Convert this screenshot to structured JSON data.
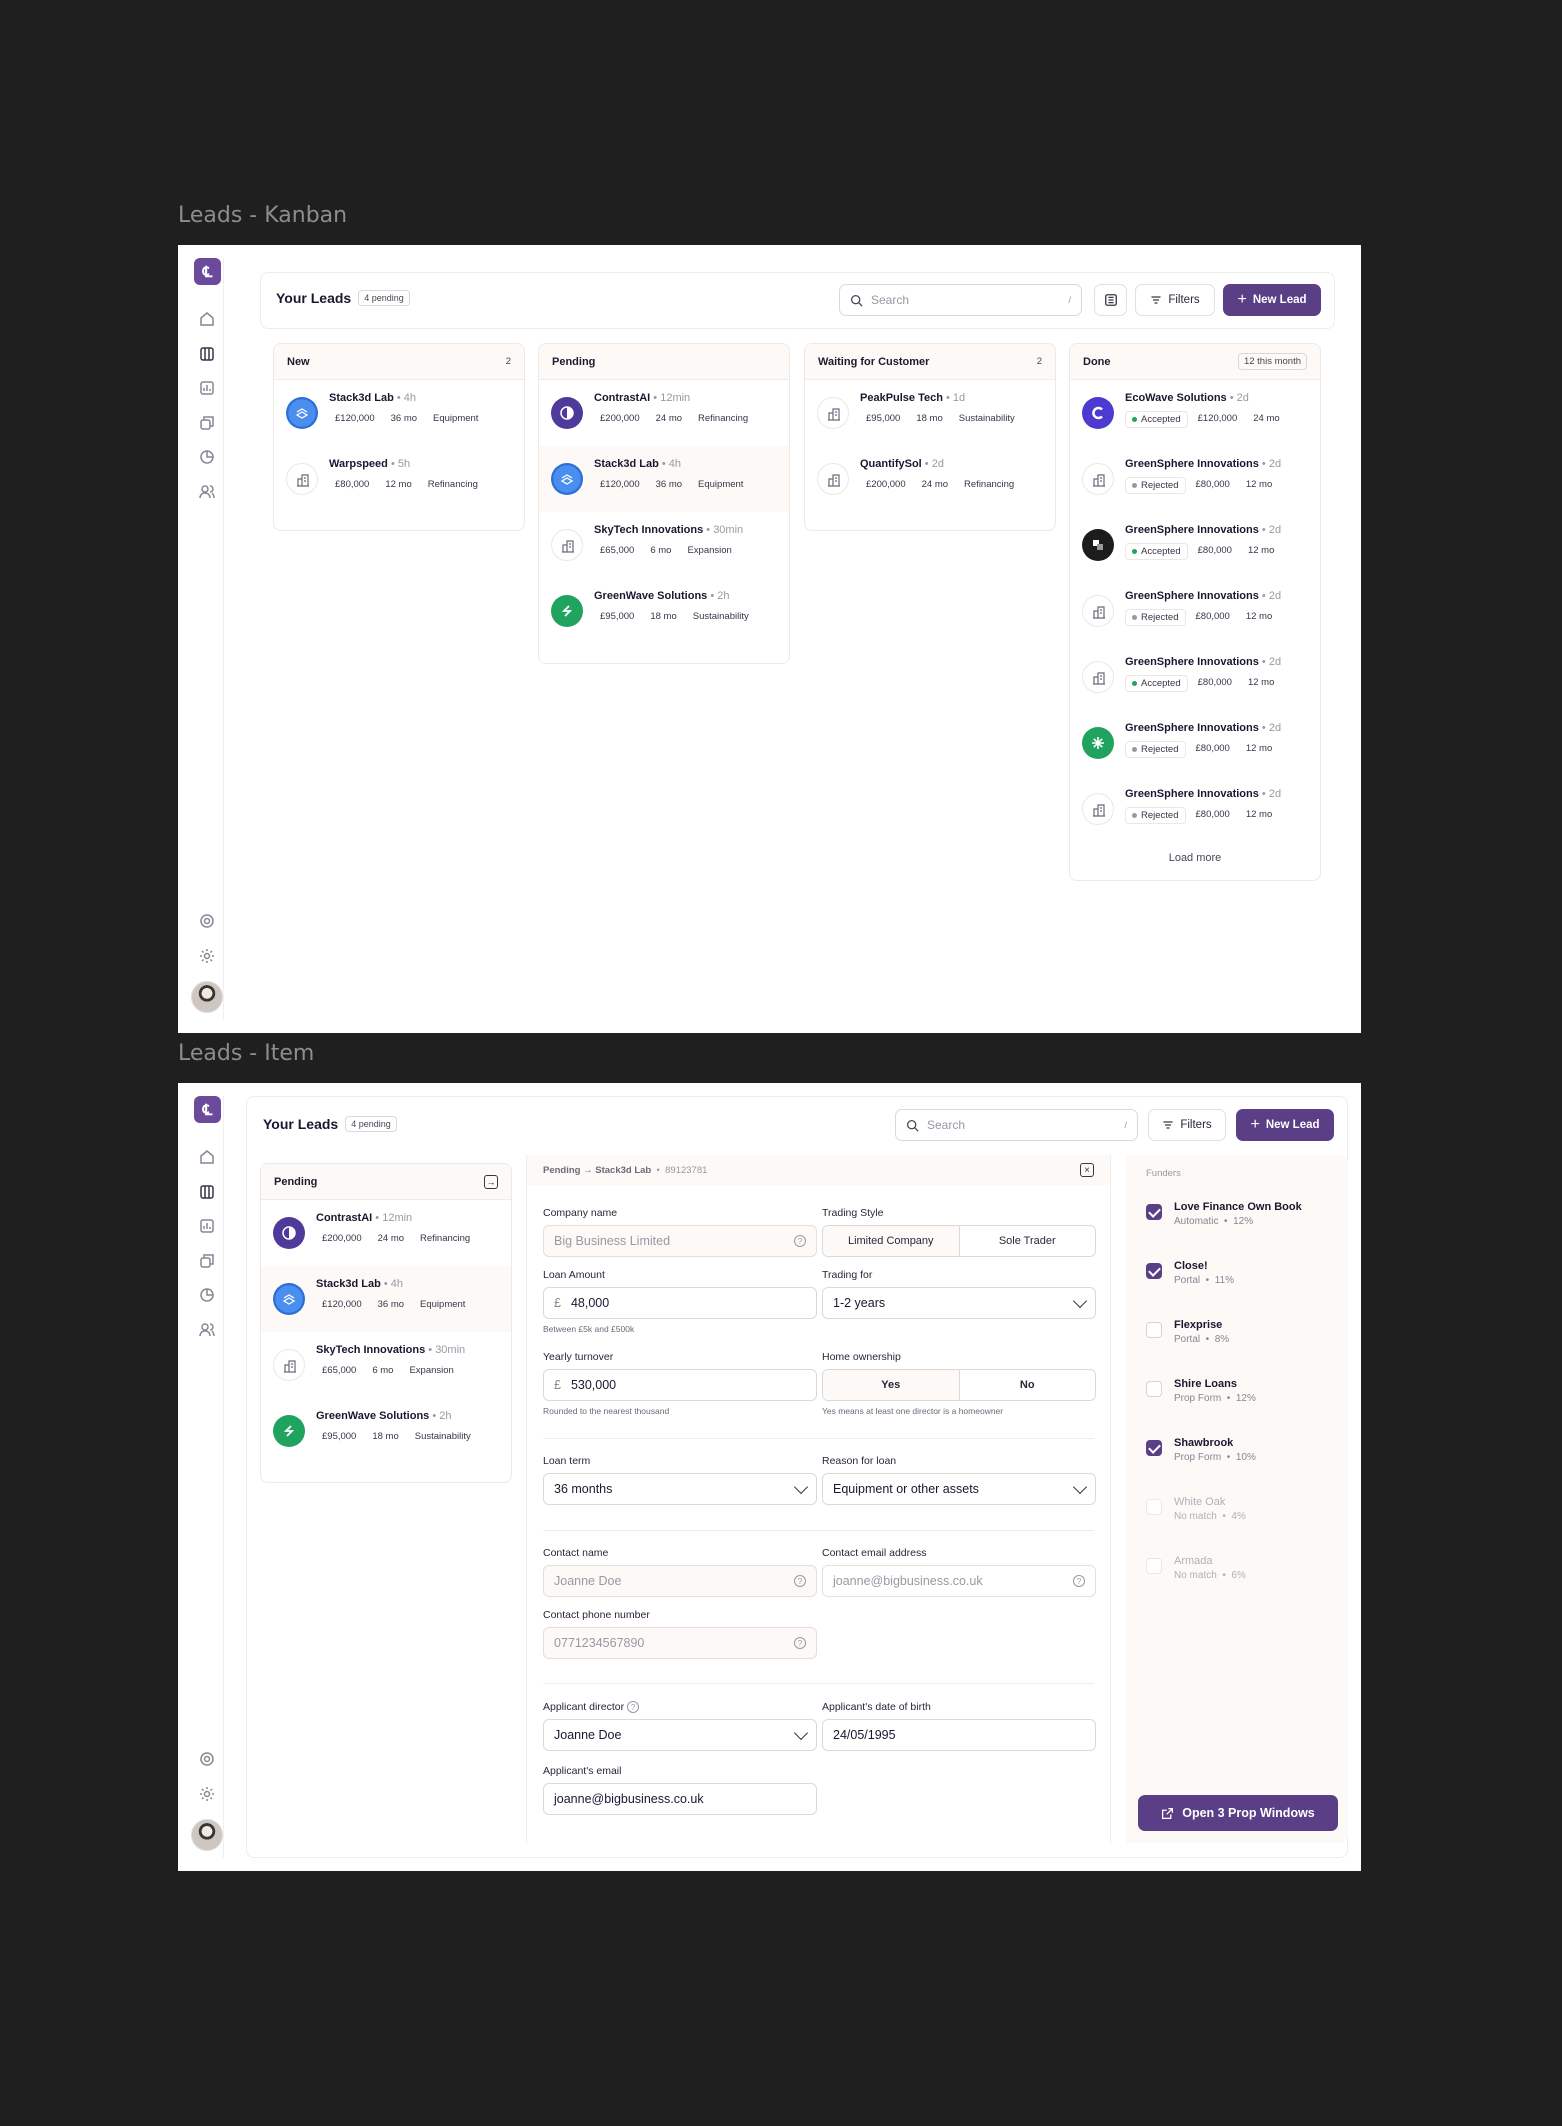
{
  "frames": {
    "kanban_title": "Leads - Kanban",
    "item_title": "Leads - Item"
  },
  "header": {
    "title": "Your Leads",
    "pending_badge": "4 pending",
    "search_placeholder": "Search",
    "search_shortcut": "/",
    "filters_label": "Filters",
    "new_lead_label": "New Lead"
  },
  "kanban": {
    "columns": [
      {
        "title": "New",
        "count": "2",
        "leads": [
          {
            "name": "Stack3d Lab",
            "ago": "4h",
            "amount": "£120,000",
            "term": "36 mo",
            "purpose": "Equipment",
            "icon": "stack3d-logo"
          },
          {
            "name": "Warpspeed",
            "ago": "5h",
            "amount": "£80,000",
            "term": "12 mo",
            "purpose": "Refinancing",
            "icon": "building-icon"
          }
        ]
      },
      {
        "title": "Pending",
        "count": "",
        "leads": [
          {
            "name": "ContrastAI",
            "ago": "12min",
            "amount": "£200,000",
            "term": "24 mo",
            "purpose": "Refinancing",
            "icon": "contrastai-logo"
          },
          {
            "name": "Stack3d Lab",
            "ago": "4h",
            "amount": "£120,000",
            "term": "36 mo",
            "purpose": "Equipment",
            "icon": "stack3d-logo"
          },
          {
            "name": "SkyTech Innovations",
            "ago": "30min",
            "amount": "£65,000",
            "term": "6 mo",
            "purpose": "Expansion",
            "icon": "building-icon"
          },
          {
            "name": "GreenWave Solutions",
            "ago": "2h",
            "amount": "£95,000",
            "term": "18 mo",
            "purpose": "Sustainability",
            "icon": "greenwave-logo"
          }
        ]
      },
      {
        "title": "Waiting for Customer",
        "count": "2",
        "leads": [
          {
            "name": "PeakPulse Tech",
            "ago": "1d",
            "amount": "£95,000",
            "term": "18 mo",
            "purpose": "Sustainability",
            "icon": "building-icon"
          },
          {
            "name": "QuantifySol",
            "ago": "2d",
            "amount": "£200,000",
            "term": "24 mo",
            "purpose": "Refinancing",
            "icon": "building-icon"
          }
        ]
      },
      {
        "title": "Done",
        "count": "12 this month",
        "leads": [
          {
            "name": "EcoWave Solutions",
            "ago": "2d",
            "status": "Accepted",
            "amount": "£120,000",
            "term": "24 mo",
            "icon": "ecowave-logo"
          },
          {
            "name": "GreenSphere Innovations",
            "ago": "2d",
            "status": "Rejected",
            "amount": "£80,000",
            "term": "12 mo",
            "icon": "building-icon"
          },
          {
            "name": "GreenSphere Innovations",
            "ago": "2d",
            "status": "Accepted",
            "amount": "£80,000",
            "term": "12 mo",
            "icon": "dark-logo"
          },
          {
            "name": "GreenSphere Innovations",
            "ago": "2d",
            "status": "Rejected",
            "amount": "£80,000",
            "term": "12 mo",
            "icon": "building-icon"
          },
          {
            "name": "GreenSphere Innovations",
            "ago": "2d",
            "status": "Accepted",
            "amount": "£80,000",
            "term": "12 mo",
            "icon": "building-icon"
          },
          {
            "name": "GreenSphere Innovations",
            "ago": "2d",
            "status": "Rejected",
            "amount": "£80,000",
            "term": "12 mo",
            "icon": "asterisk-logo"
          },
          {
            "name": "GreenSphere Innovations",
            "ago": "2d",
            "status": "Rejected",
            "amount": "£80,000",
            "term": "12 mo",
            "icon": "building-icon"
          }
        ],
        "load_more": "Load more"
      }
    ]
  },
  "item": {
    "breadcrumb": {
      "status": "Pending",
      "arrow": "→",
      "company": "Stack3d Lab",
      "id": "89123781"
    },
    "fields": {
      "company_name": {
        "label": "Company name",
        "placeholder": "Big Business Limited"
      },
      "trading_style": {
        "label": "Trading Style",
        "options": [
          "Limited Company",
          "Sole Trader"
        ]
      },
      "loan_amount": {
        "label": "Loan Amount",
        "currency": "£",
        "value": "48,000",
        "hint": "Between £5k and £500k"
      },
      "trading_for": {
        "label": "Trading for",
        "value": "1-2 years"
      },
      "yearly_turnover": {
        "label": "Yearly turnover",
        "currency": "£",
        "value": "530,000",
        "hint": "Rounded to the nearest thousand"
      },
      "home_ownership": {
        "label": "Home ownership",
        "options": [
          "Yes",
          "No"
        ],
        "hint": "Yes means at least one director is a homeowner"
      },
      "loan_term": {
        "label": "Loan term",
        "value": "36 months"
      },
      "reason": {
        "label": "Reason for loan",
        "value": "Equipment or other assets"
      },
      "contact_name": {
        "label": "Contact name",
        "placeholder": "Joanne Doe"
      },
      "contact_email": {
        "label": "Contact email address",
        "placeholder": "joanne@bigbusiness.co.uk"
      },
      "contact_phone": {
        "label": "Contact phone number",
        "placeholder": "0771234567890"
      },
      "applicant_director": {
        "label": "Applicant director",
        "value": "Joanne Doe"
      },
      "applicant_dob": {
        "label": "Applicant's date of birth",
        "value": "24/05/1995"
      },
      "applicant_email": {
        "label": "Applicant's email",
        "value": "joanne@bigbusiness.co.uk"
      }
    },
    "funders": {
      "title": "Funders",
      "items": [
        {
          "name": "Love Finance Own Book",
          "sub": "Automatic",
          "rate": "12%",
          "checked": true
        },
        {
          "name": "Close!",
          "sub": "Portal",
          "rate": "11%",
          "checked": true
        },
        {
          "name": "Flexprise",
          "sub": "Portal",
          "rate": "8%",
          "checked": false
        },
        {
          "name": "Shire Loans",
          "sub": "Prop Form",
          "rate": "12%",
          "checked": false
        },
        {
          "name": "Shawbrook",
          "sub": "Prop Form",
          "rate": "10%",
          "checked": true
        },
        {
          "name": "White Oak",
          "sub": "No match",
          "rate": "4%",
          "checked": false
        },
        {
          "name": "Armada",
          "sub": "No match",
          "rate": "6%",
          "checked": false
        }
      ],
      "action_label": "Open 3 Prop Windows"
    }
  },
  "colors": {
    "brand": "#5a3e86",
    "accepted": "#20a35f",
    "rejected": "#9c97a3"
  }
}
